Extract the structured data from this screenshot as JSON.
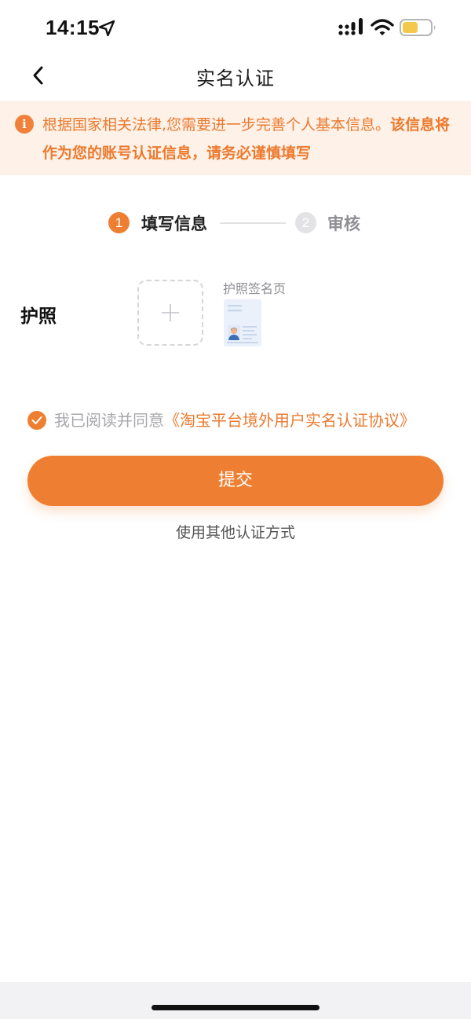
{
  "status_bar": {
    "time": "14:15",
    "battery_color": "#f2c94c"
  },
  "nav": {
    "title": "实名认证",
    "back_icon": "chevron-left-icon"
  },
  "notice": {
    "icon": "info-icon",
    "text_normal": "根据国家相关法律,您需要进一步完善个人基本信息。",
    "text_bold": "该信息将作为您的账号认证信息，请务必谨慎填写"
  },
  "steps": [
    {
      "number": "1",
      "label": "填写信息",
      "active": true
    },
    {
      "number": "2",
      "label": "审核",
      "active": false
    }
  ],
  "passport": {
    "label": "护照",
    "upload_icon": "plus-icon",
    "sample_caption": "护照签名页",
    "sample_icon": "passport-sample-icon"
  },
  "agreement": {
    "checked": true,
    "prefix": "我已阅读并同意",
    "link": "《淘宝平台境外用户实名认证协议》"
  },
  "actions": {
    "submit_label": "提交",
    "other_method_label": "使用其他认证方式"
  },
  "colors": {
    "accent": "#ee7f32",
    "notice_bg": "#fdf1e8",
    "notice_text": "#ec7a2f"
  }
}
